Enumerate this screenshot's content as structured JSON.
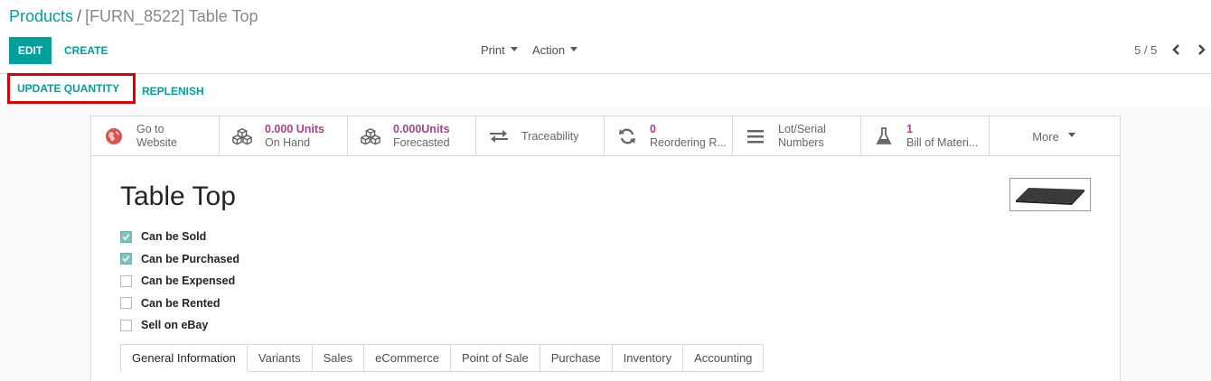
{
  "breadcrumb": {
    "parent": "Products",
    "separator": "/",
    "current": "[FURN_8522] Table Top"
  },
  "toolbar": {
    "edit_label": "EDIT",
    "create_label": "CREATE",
    "print_label": "Print",
    "action_label": "Action"
  },
  "pager": {
    "value": "5 / 5"
  },
  "statusbar": {
    "update_quantity_label": "UPDATE QUANTITY",
    "replenish_label": "REPLENISH"
  },
  "smart_buttons": [
    {
      "icon": "globe-icon",
      "value": "",
      "label_top": "Go to",
      "label": "Website"
    },
    {
      "icon": "cubes-icon",
      "value": "0.000 Units",
      "label": "On Hand"
    },
    {
      "icon": "cubes-icon",
      "value": "0.000Units",
      "label": "Forecasted"
    },
    {
      "icon": "exchange-icon",
      "value": "",
      "label": "Traceability"
    },
    {
      "icon": "refresh-icon",
      "value": "0",
      "label": "Reordering R..."
    },
    {
      "icon": "bars-icon",
      "value": "",
      "label_top": "Lot/Serial",
      "label": "Numbers"
    },
    {
      "icon": "flask-icon",
      "value": "1",
      "label": "Bill of Materi..."
    },
    {
      "icon": "caret-down-icon",
      "value": "",
      "label": "More"
    }
  ],
  "product": {
    "name": "Table Top",
    "checkboxes": [
      {
        "label": "Can be Sold",
        "checked": true
      },
      {
        "label": "Can be Purchased",
        "checked": true
      },
      {
        "label": "Can be Expensed",
        "checked": false
      },
      {
        "label": "Can be Rented",
        "checked": false
      },
      {
        "label": "Sell on eBay",
        "checked": false
      }
    ]
  },
  "tabs": [
    "General Information",
    "Variants",
    "Sales",
    "eCommerce",
    "Point of Sale",
    "Purchase",
    "Inventory",
    "Accounting"
  ],
  "colors": {
    "primary": "#00a09d",
    "smart_value": "#a24689",
    "highlight": "#e00000"
  }
}
